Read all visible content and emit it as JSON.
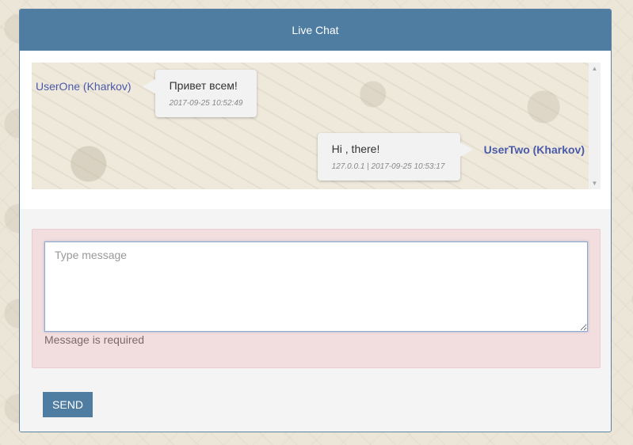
{
  "header": {
    "title": "Live Chat"
  },
  "messages": [
    {
      "user": "UserOne (Kharkov)",
      "text": "Привет всем!",
      "meta": "2017-09-25 10:52:49",
      "side": "left"
    },
    {
      "user": "UserTwo (Kharkov)",
      "text": "Hi , there!",
      "meta": "127.0.0.1 | 2017-09-25 10:53:17",
      "side": "right"
    }
  ],
  "scrollbar": {
    "up_icon": "triangle-up",
    "down_icon": "triangle-down"
  },
  "form": {
    "message_placeholder": "Type message",
    "message_value": "",
    "error": "Message is required",
    "send_label": "SEND"
  },
  "colors": {
    "accent": "#4f7da1",
    "username": "#4a5aa8",
    "error_bg": "#f2dede"
  }
}
